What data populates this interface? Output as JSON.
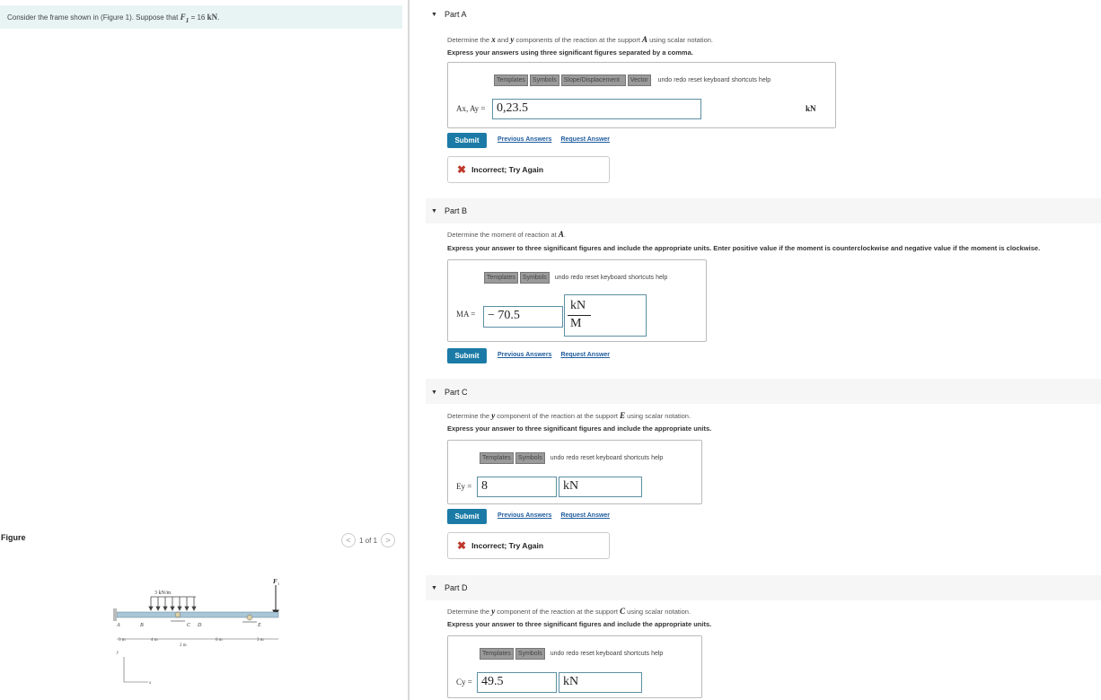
{
  "problem": {
    "text_pre": "Consider the frame shown in (Figure 1). Suppose that",
    "symbol": "F",
    "sub": "1",
    "eq": "= 16",
    "unit": "kN",
    "tail": "."
  },
  "figure": {
    "label": "Figure",
    "pager": "1 of 1",
    "prev_icon": "<",
    "next_icon": ">",
    "load_label": "3 kN/m",
    "force_label": "F",
    "force_sub": "1",
    "points": [
      "A",
      "B",
      "C",
      "D",
      "E"
    ],
    "dims": [
      "3 m",
      "4 m",
      "2 m",
      "6 m",
      "3 m"
    ],
    "axis_y": "y",
    "axis_x": "x"
  },
  "parts": [
    {
      "title": "Part A",
      "desc_pre": "Determine the",
      "desc_x": "x",
      "desc_and": "and",
      "desc_y": "y",
      "desc_mid": "components of the reaction at the support",
      "desc_pt": "A",
      "desc_post": "using scalar notation.",
      "instruction": "Express your answers using three significant figures separated by a comma.",
      "toolbar": [
        "Templates",
        "Symbols",
        "Slope/Displacement",
        "Vector",
        "undo",
        "redo",
        "reset",
        "keyboard shortcuts",
        "help"
      ],
      "var_label": "Ax, Ay =",
      "value": "0,23.5",
      "unit": "kN",
      "submit": "Submit",
      "link1": "Previous Answers",
      "link2": "Request Answer",
      "feedback": "Incorrect; Try Again"
    },
    {
      "title": "Part B",
      "desc_pre": "Determine the moment of reaction at",
      "desc_pt": "A",
      "desc_post": ".",
      "instruction": "Express your answer to three significant figures and include the appropriate units. Enter positive value if the moment is counterclockwise and negative value if the moment is clockwise.",
      "toolbar": [
        "Templates",
        "Symbols",
        "undo",
        "redo",
        "reset",
        "keyboard shortcuts",
        "help"
      ],
      "var_label": "MA =",
      "value": "− 70.5",
      "unit_num": "kN",
      "unit_den": "M",
      "submit": "Submit",
      "link1": "Previous Answers",
      "link2": "Request Answer"
    },
    {
      "title": "Part C",
      "desc_pre": "Determine the",
      "desc_y": "y",
      "desc_mid": "component of the reaction at the support",
      "desc_pt": "E",
      "desc_post": "using scalar notation.",
      "instruction": "Express your answer to three significant figures and include the appropriate units.",
      "toolbar": [
        "Templates",
        "Symbols",
        "undo",
        "redo",
        "reset",
        "keyboard shortcuts",
        "help"
      ],
      "var_label": "Ey =",
      "value": "8",
      "unit": "kN",
      "submit": "Submit",
      "link1": "Previous Answers",
      "link2": "Request Answer",
      "feedback": "Incorrect; Try Again"
    },
    {
      "title": "Part D",
      "desc_pre": "Determine the",
      "desc_y": "y",
      "desc_mid": "component of the reaction at the support",
      "desc_pt": "C",
      "desc_post": "using scalar notation.",
      "instruction": "Express your answer to three significant figures and include the appropriate units.",
      "toolbar": [
        "Templates",
        "Symbols",
        "undo",
        "redo",
        "reset",
        "keyboard shortcuts",
        "help"
      ],
      "var_label": "Cy =",
      "value": "49.5",
      "unit": "kN"
    }
  ]
}
